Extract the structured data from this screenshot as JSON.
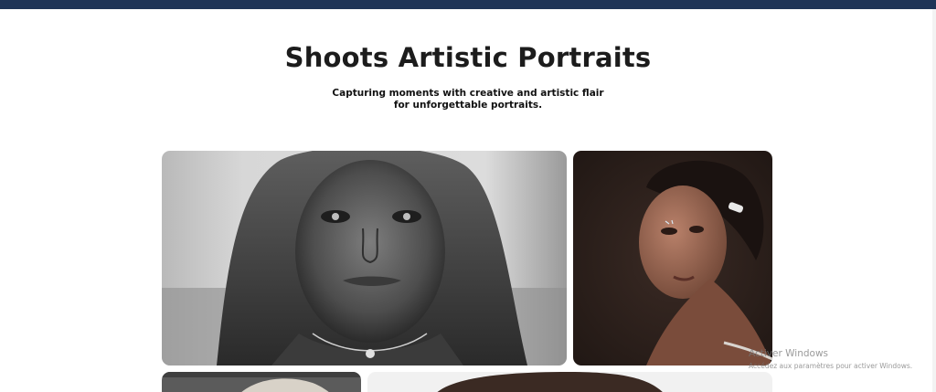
{
  "header": {
    "title": "Shoots Artistic Portraits",
    "subtitle_line1": "Capturing moments with creative and artistic flair",
    "subtitle_line2": "for unforgettable portraits."
  },
  "gallery": {
    "photos": [
      {
        "subject": "black-and-white portrait of a person in a hood"
      },
      {
        "subject": "portrait of a woman with a hair clip looking over her shoulder"
      },
      {
        "subject": "portrait (partially visible)"
      },
      {
        "subject": "portrait (partially visible)"
      }
    ]
  },
  "watermark": {
    "title": "Activer Windows",
    "subtitle": "Accédez aux paramètres pour activer Windows."
  },
  "colors": {
    "top_bar": "#1f3557",
    "title": "#1c1c1c",
    "background": "#ffffff"
  }
}
